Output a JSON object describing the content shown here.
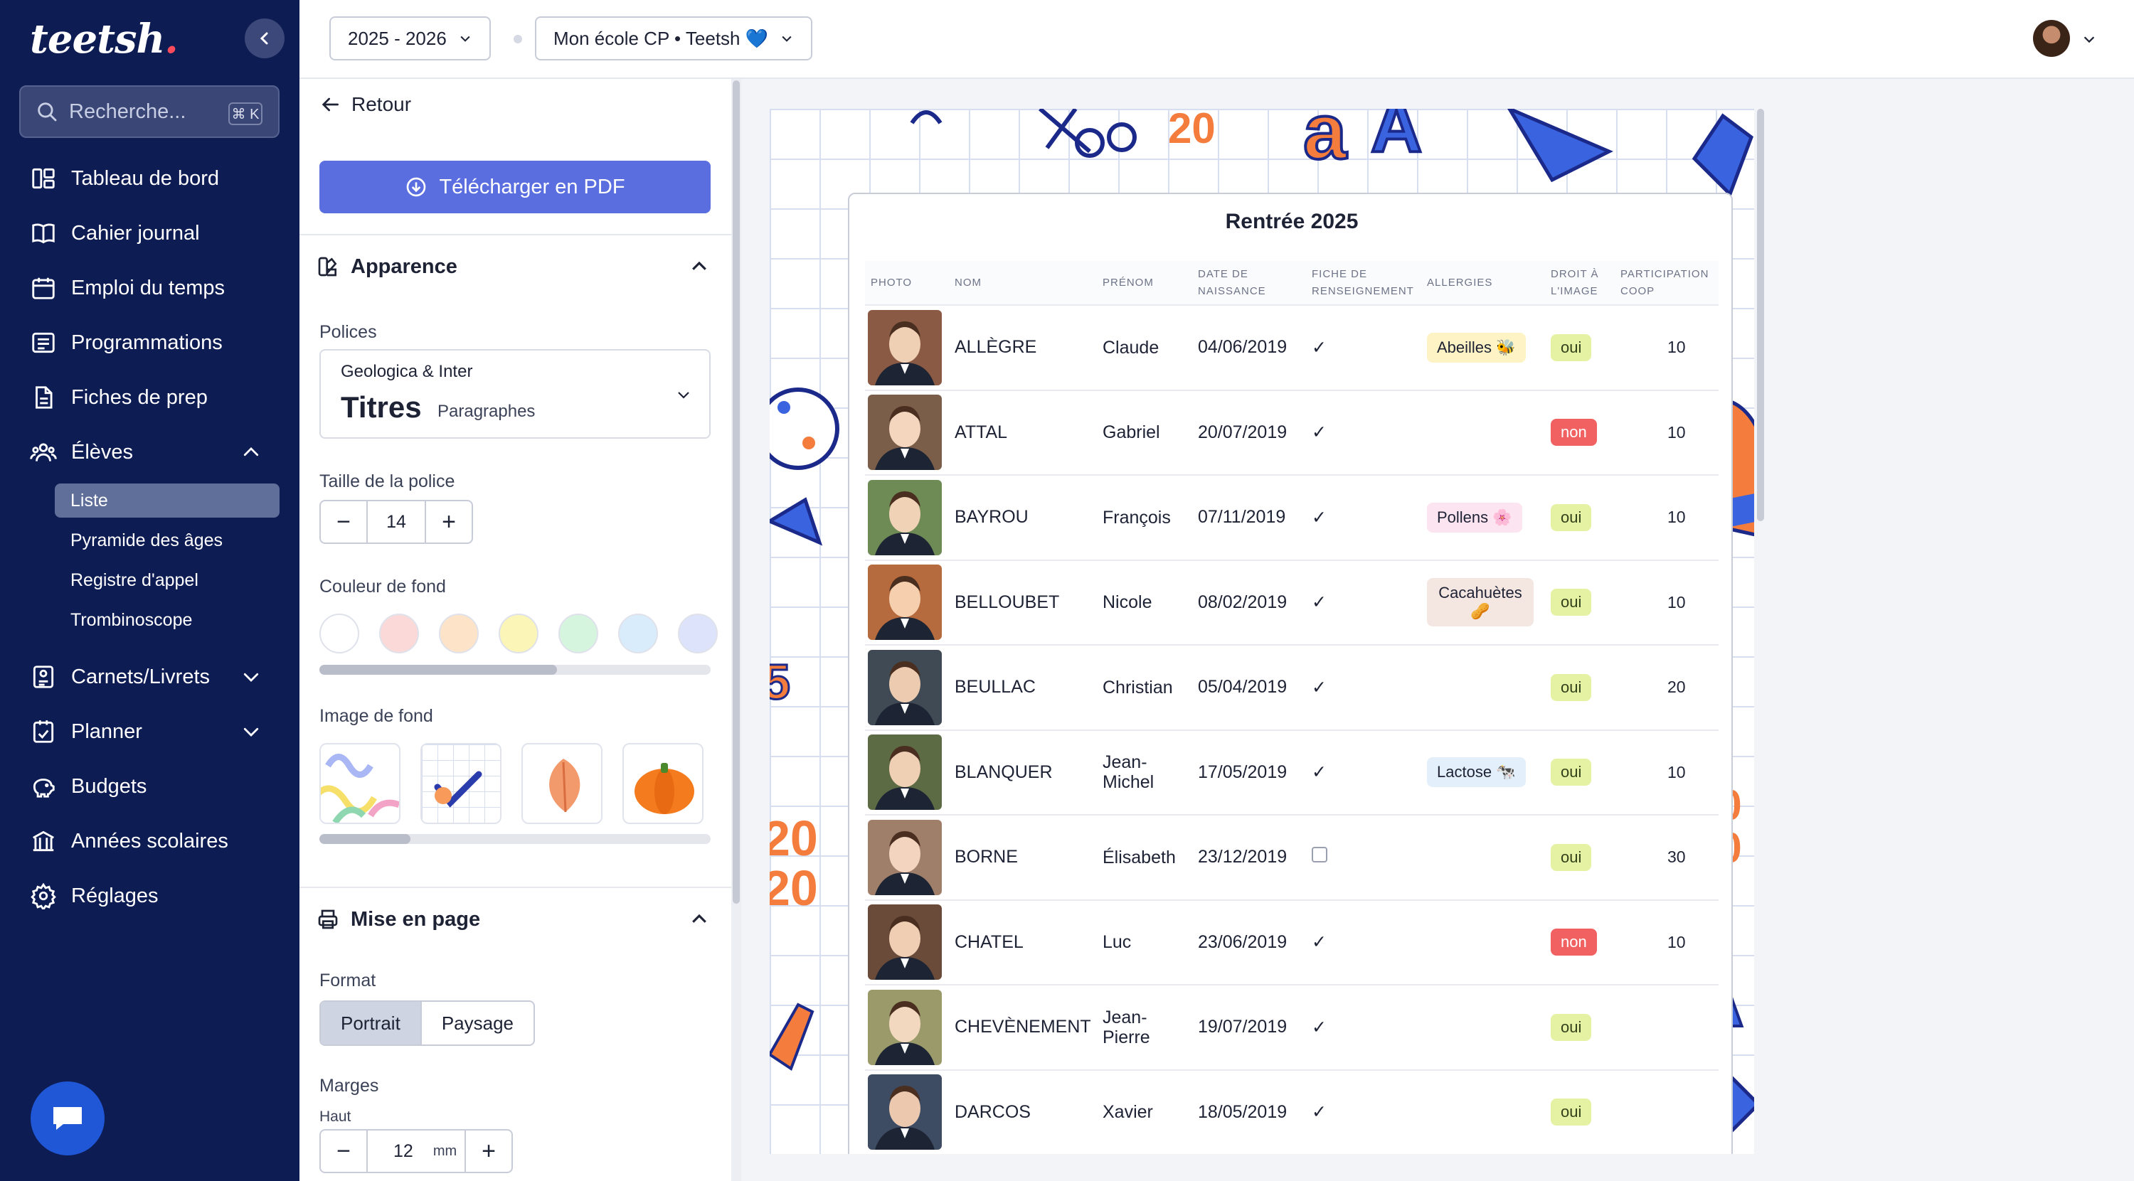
{
  "sidebar": {
    "logo": "teetsh",
    "search_placeholder": "Recherche...",
    "search_shortcut": "⌘ K",
    "items": [
      {
        "label": "Tableau de bord"
      },
      {
        "label": "Cahier journal"
      },
      {
        "label": "Emploi du temps"
      },
      {
        "label": "Programmations"
      },
      {
        "label": "Fiches de prep"
      },
      {
        "label": "Élèves"
      },
      {
        "label": "Carnets/Livrets"
      },
      {
        "label": "Planner"
      },
      {
        "label": "Budgets"
      },
      {
        "label": "Années scolaires"
      },
      {
        "label": "Réglages"
      }
    ],
    "subitems": [
      {
        "label": "Liste"
      },
      {
        "label": "Pyramide des âges"
      },
      {
        "label": "Registre d'appel"
      },
      {
        "label": "Trombinoscope"
      }
    ]
  },
  "topbar": {
    "year": "2025 - 2026",
    "school": "Mon école CP • Teetsh 💙"
  },
  "panel": {
    "back": "Retour",
    "download": "Télécharger en PDF",
    "appearance": "Apparence",
    "fonts_label": "Polices",
    "fonts_value": "Geologica & Inter",
    "fonts_titles": "Titres",
    "fonts_paragraphs": "Paragraphes",
    "font_size_label": "Taille de la police",
    "font_size": "14",
    "bg_color_label": "Couleur de fond",
    "bg_image_label": "Image de fond",
    "layout": "Mise en page",
    "format_label": "Format",
    "format_portrait": "Portrait",
    "format_landscape": "Paysage",
    "margins_label": "Marges",
    "margin_top_label": "Haut",
    "margin_top": "12",
    "margin_unit": "mm"
  },
  "colors": {
    "swatches": [
      "#ffffff",
      "#fbd9d9",
      "#fde3c8",
      "#fbf6b8",
      "#d6f5df",
      "#d9ecfc",
      "#dde3fb"
    ],
    "accent": "#5a6ee0",
    "sidebar_bg": "#0e1c54"
  },
  "sheet": {
    "title": "Rentrée 2025",
    "headers": [
      "PHOTO",
      "NOM",
      "PRÉNOM",
      "DATE DE NAISSANCE",
      "FICHE DE RENSEIGNEMENT",
      "ALLERGIES",
      "DROIT À L'IMAGE",
      "PARTICIPATION COOP"
    ],
    "rows": [
      {
        "nom": "ALLÈGRE",
        "prenom": "Claude",
        "date": "04/06/2019",
        "fiche": "✓",
        "allergie": "Abeilles 🐝",
        "droit": "oui",
        "coop": "10"
      },
      {
        "nom": "ATTAL",
        "prenom": "Gabriel",
        "date": "20/07/2019",
        "fiche": "✓",
        "allergie": "",
        "droit": "non",
        "coop": "10"
      },
      {
        "nom": "BAYROU",
        "prenom": "François",
        "date": "07/11/2019",
        "fiche": "✓",
        "allergie": "Pollens 🌸",
        "droit": "oui",
        "coop": "10"
      },
      {
        "nom": "BELLOUBET",
        "prenom": "Nicole",
        "date": "08/02/2019",
        "fiche": "✓",
        "allergie": "Cacahuètes 🥜",
        "droit": "oui",
        "coop": "10"
      },
      {
        "nom": "BEULLAC",
        "prenom": "Christian",
        "date": "05/04/2019",
        "fiche": "✓",
        "allergie": "",
        "droit": "oui",
        "coop": "20"
      },
      {
        "nom": "BLANQUER",
        "prenom": "Jean-Michel",
        "date": "17/05/2019",
        "fiche": "✓",
        "allergie": "Lactose 🐄",
        "droit": "oui",
        "coop": "10"
      },
      {
        "nom": "BORNE",
        "prenom": "Élisabeth",
        "date": "23/12/2019",
        "fiche": "",
        "allergie": "",
        "droit": "oui",
        "coop": "30"
      },
      {
        "nom": "CHATEL",
        "prenom": "Luc",
        "date": "23/06/2019",
        "fiche": "✓",
        "allergie": "",
        "droit": "non",
        "coop": "10"
      },
      {
        "nom": "CHEVÈNEMENT",
        "prenom": "Jean-Pierre",
        "date": "19/07/2019",
        "fiche": "✓",
        "allergie": "",
        "droit": "oui",
        "coop": ""
      },
      {
        "nom": "DARCOS",
        "prenom": "Xavier",
        "date": "18/05/2019",
        "fiche": "✓",
        "allergie": "",
        "droit": "oui",
        "coop": ""
      }
    ]
  }
}
